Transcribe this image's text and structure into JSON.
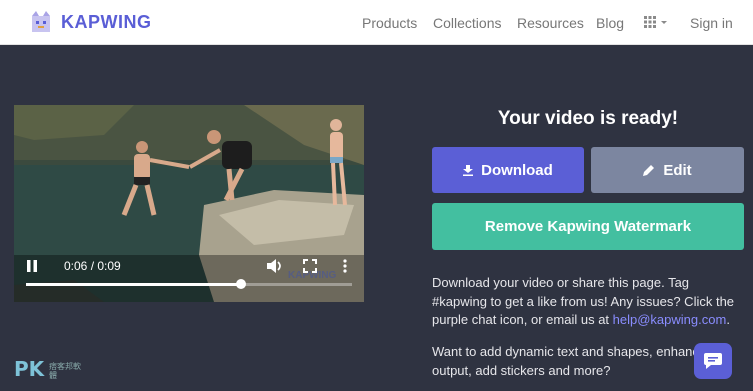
{
  "nav": {
    "brand": "KAPWING",
    "links": [
      "Products",
      "Collections",
      "Resources",
      "Blog"
    ],
    "signin": "Sign in"
  },
  "video": {
    "time": "0:06 / 0:09",
    "progress": 0.66,
    "watermark": "KAPWING"
  },
  "panel": {
    "title": "Your video is ready!",
    "download_label": "Download",
    "edit_label": "Edit",
    "remove_label": "Remove Kapwing Watermark",
    "info1_text": "Download your video or share this page. Tag #kapwing to get a like from us! Any issues? Click the purple chat icon, or email us at ",
    "info1_email": "help@kapwing.com",
    "info1_end": ".",
    "info2_text": "Want to add dynamic text and shapes, enhance output, add stickers and more?"
  },
  "watermark_site": {
    "logo": "PK",
    "subtitle": "痞客邦軟體"
  },
  "colors": {
    "brand": "#5a5ed6",
    "download": "#5b5fd6",
    "edit": "#7c86a0",
    "remove": "#43bfa0",
    "background": "#2f3341"
  }
}
